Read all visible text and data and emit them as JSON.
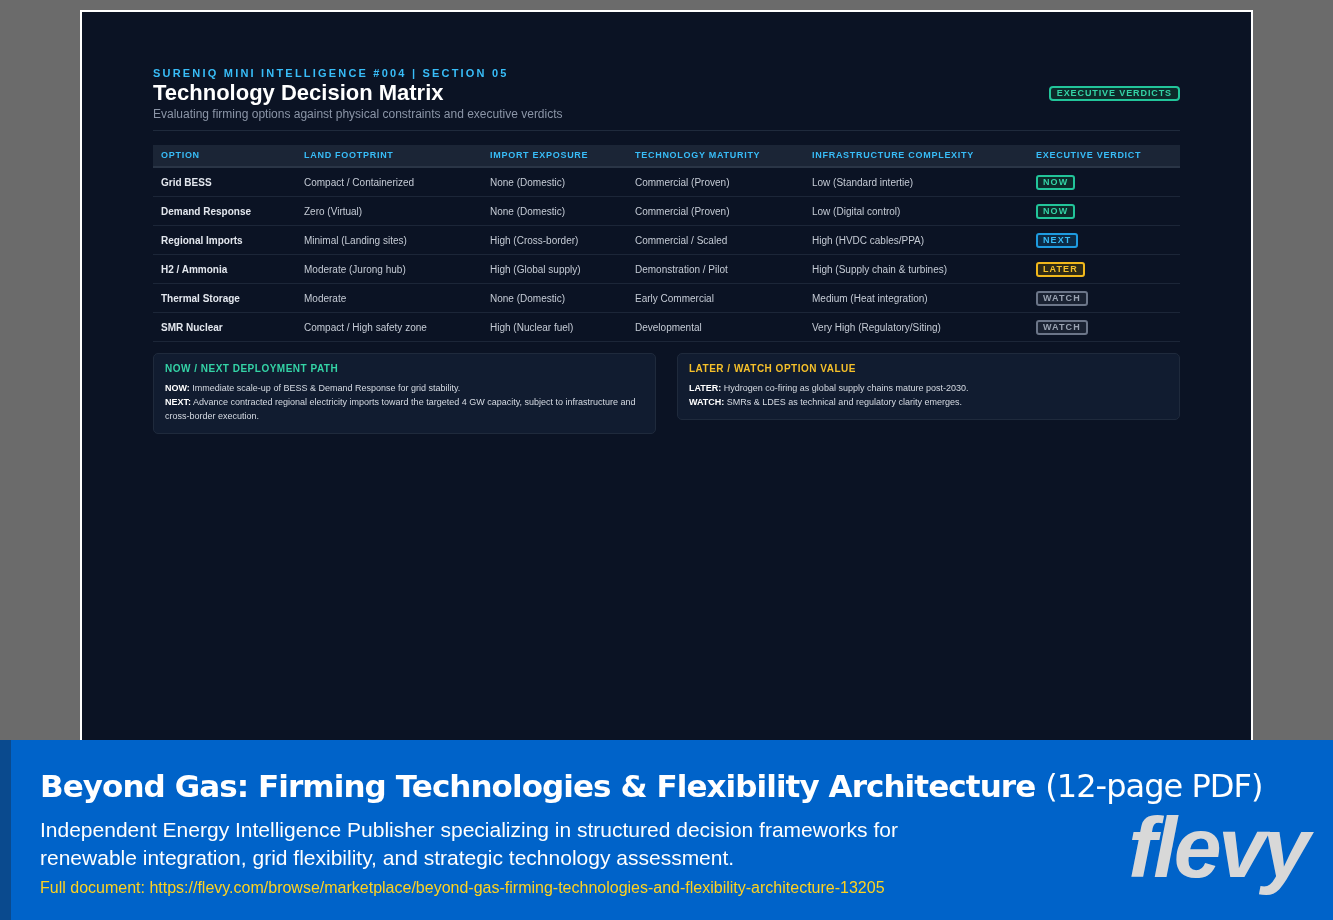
{
  "slide": {
    "eyebrow": "SURENIQ MINI INTELLIGENCE #004 | SECTION 05",
    "title": "Technology Decision Matrix",
    "subtitle": "Evaluating firming options against physical constraints and executive verdicts",
    "badge": "EXECUTIVE VERDICTS",
    "table": {
      "columns": [
        "OPTION",
        "LAND FOOTPRINT",
        "IMPORT EXPOSURE",
        "TECHNOLOGY MATURITY",
        "INFRASTRUCTURE COMPLEXITY",
        "EXECUTIVE VERDICT"
      ],
      "rows": [
        {
          "option": "Grid BESS",
          "land": "Compact / Containerized",
          "import": "None (Domestic)",
          "maturity": "Commercial (Proven)",
          "complexity": "Low (Standard intertie)",
          "verdict": {
            "label": "NOW",
            "kind": "now"
          }
        },
        {
          "option": "Demand Response",
          "land": "Zero (Virtual)",
          "import": "None (Domestic)",
          "maturity": "Commercial (Proven)",
          "complexity": "Low (Digital control)",
          "verdict": {
            "label": "NOW",
            "kind": "now"
          }
        },
        {
          "option": "Regional Imports",
          "land": "Minimal (Landing sites)",
          "import": "High (Cross-border)",
          "maturity": "Commercial / Scaled",
          "complexity": "High (HVDC cables/PPA)",
          "verdict": {
            "label": "NEXT",
            "kind": "next"
          }
        },
        {
          "option": "H2 / Ammonia",
          "land": "Moderate (Jurong hub)",
          "import": "High (Global supply)",
          "maturity": "Demonstration / Pilot",
          "complexity": "High (Supply chain & turbines)",
          "verdict": {
            "label": "LATER",
            "kind": "later"
          }
        },
        {
          "option": "Thermal Storage",
          "land": "Moderate",
          "import": "None (Domestic)",
          "maturity": "Early Commercial",
          "complexity": "Medium (Heat integration)",
          "verdict": {
            "label": "WATCH",
            "kind": "watch"
          }
        },
        {
          "option": "SMR Nuclear",
          "land": "Compact / High safety zone",
          "import": "High (Nuclear fuel)",
          "maturity": "Developmental",
          "complexity": "Very High (Regulatory/Siting)",
          "verdict": {
            "label": "WATCH",
            "kind": "watch"
          }
        }
      ]
    },
    "notes": [
      {
        "kind": "now",
        "title": "NOW / NEXT DEPLOYMENT PATH",
        "lines": [
          "**NOW:** Immediate scale-up of BESS & Demand Response for grid stability.",
          "**NEXT:** Advance contracted regional electricity imports toward the targeted 4 GW capacity, subject to infrastructure and cross-border execution."
        ]
      },
      {
        "kind": "later",
        "title": "LATER / WATCH OPTION VALUE",
        "lines": [
          "**LATER:** Hydrogen co-firing as global supply chains mature post-2030.",
          "**WATCH:** SMRs & LDES as technical and regulatory clarity emerges."
        ]
      }
    ]
  },
  "banner": {
    "title": "Beyond Gas: Firming Technologies & Flexibility Architecture",
    "pages": "(12-page PDF)",
    "description": "Independent Energy Intelligence Publisher specializing in structured decision frameworks for renewable integration, grid flexibility, and strategic technology assessment.",
    "link": "Full document: https://flevy.com/browse/marketplace/beyond-gas-firming-technologies-and-flexibility-architecture-13205",
    "logo": "flevy"
  }
}
